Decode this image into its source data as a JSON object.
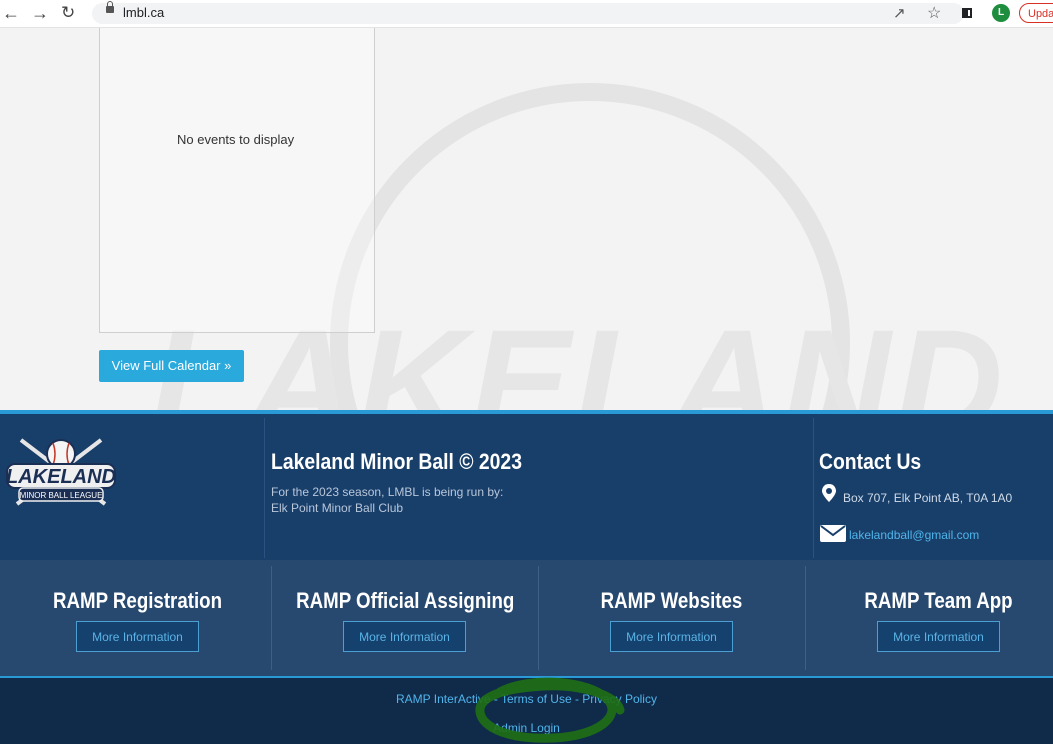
{
  "browser": {
    "back_icon": "back-arrow-icon",
    "forward_icon": "forward-arrow-icon",
    "reload_icon": "reload-icon",
    "url": "lmbl.ca",
    "profile_initial": "L",
    "update_label": "Upda"
  },
  "calendar": {
    "empty_text": "No events to display",
    "view_button": "View Full Calendar »"
  },
  "footer": {
    "title": "Lakeland Minor Ball © 2023",
    "sub_line1": "For the 2023 season, LMBL is being run by:",
    "sub_line2": "Elk Point Minor Ball Club",
    "logo_text_main": "LAKELAND",
    "logo_text_sub": "MINOR BALL LEAGUE",
    "contact": {
      "title": "Contact Us",
      "address": "Box 707, Elk Point AB, T0A 1A0",
      "email": "lakelandball@gmail.com"
    }
  },
  "ramp": [
    {
      "title": "RAMP Registration",
      "button": "More Information"
    },
    {
      "title": "RAMP Official Assigning",
      "button": "More Information"
    },
    {
      "title": "RAMP Websites",
      "button": "More Information"
    },
    {
      "title": "RAMP Team App",
      "button": "More Information"
    }
  ],
  "bottom": {
    "links": "RAMP InterActive - Terms of Use - Privacy Policy",
    "admin_login": "Admin Login"
  },
  "colors": {
    "accent_blue": "#29a9dc",
    "footer_dark": "#183e6a",
    "scribble_green": "#1f6f14"
  }
}
